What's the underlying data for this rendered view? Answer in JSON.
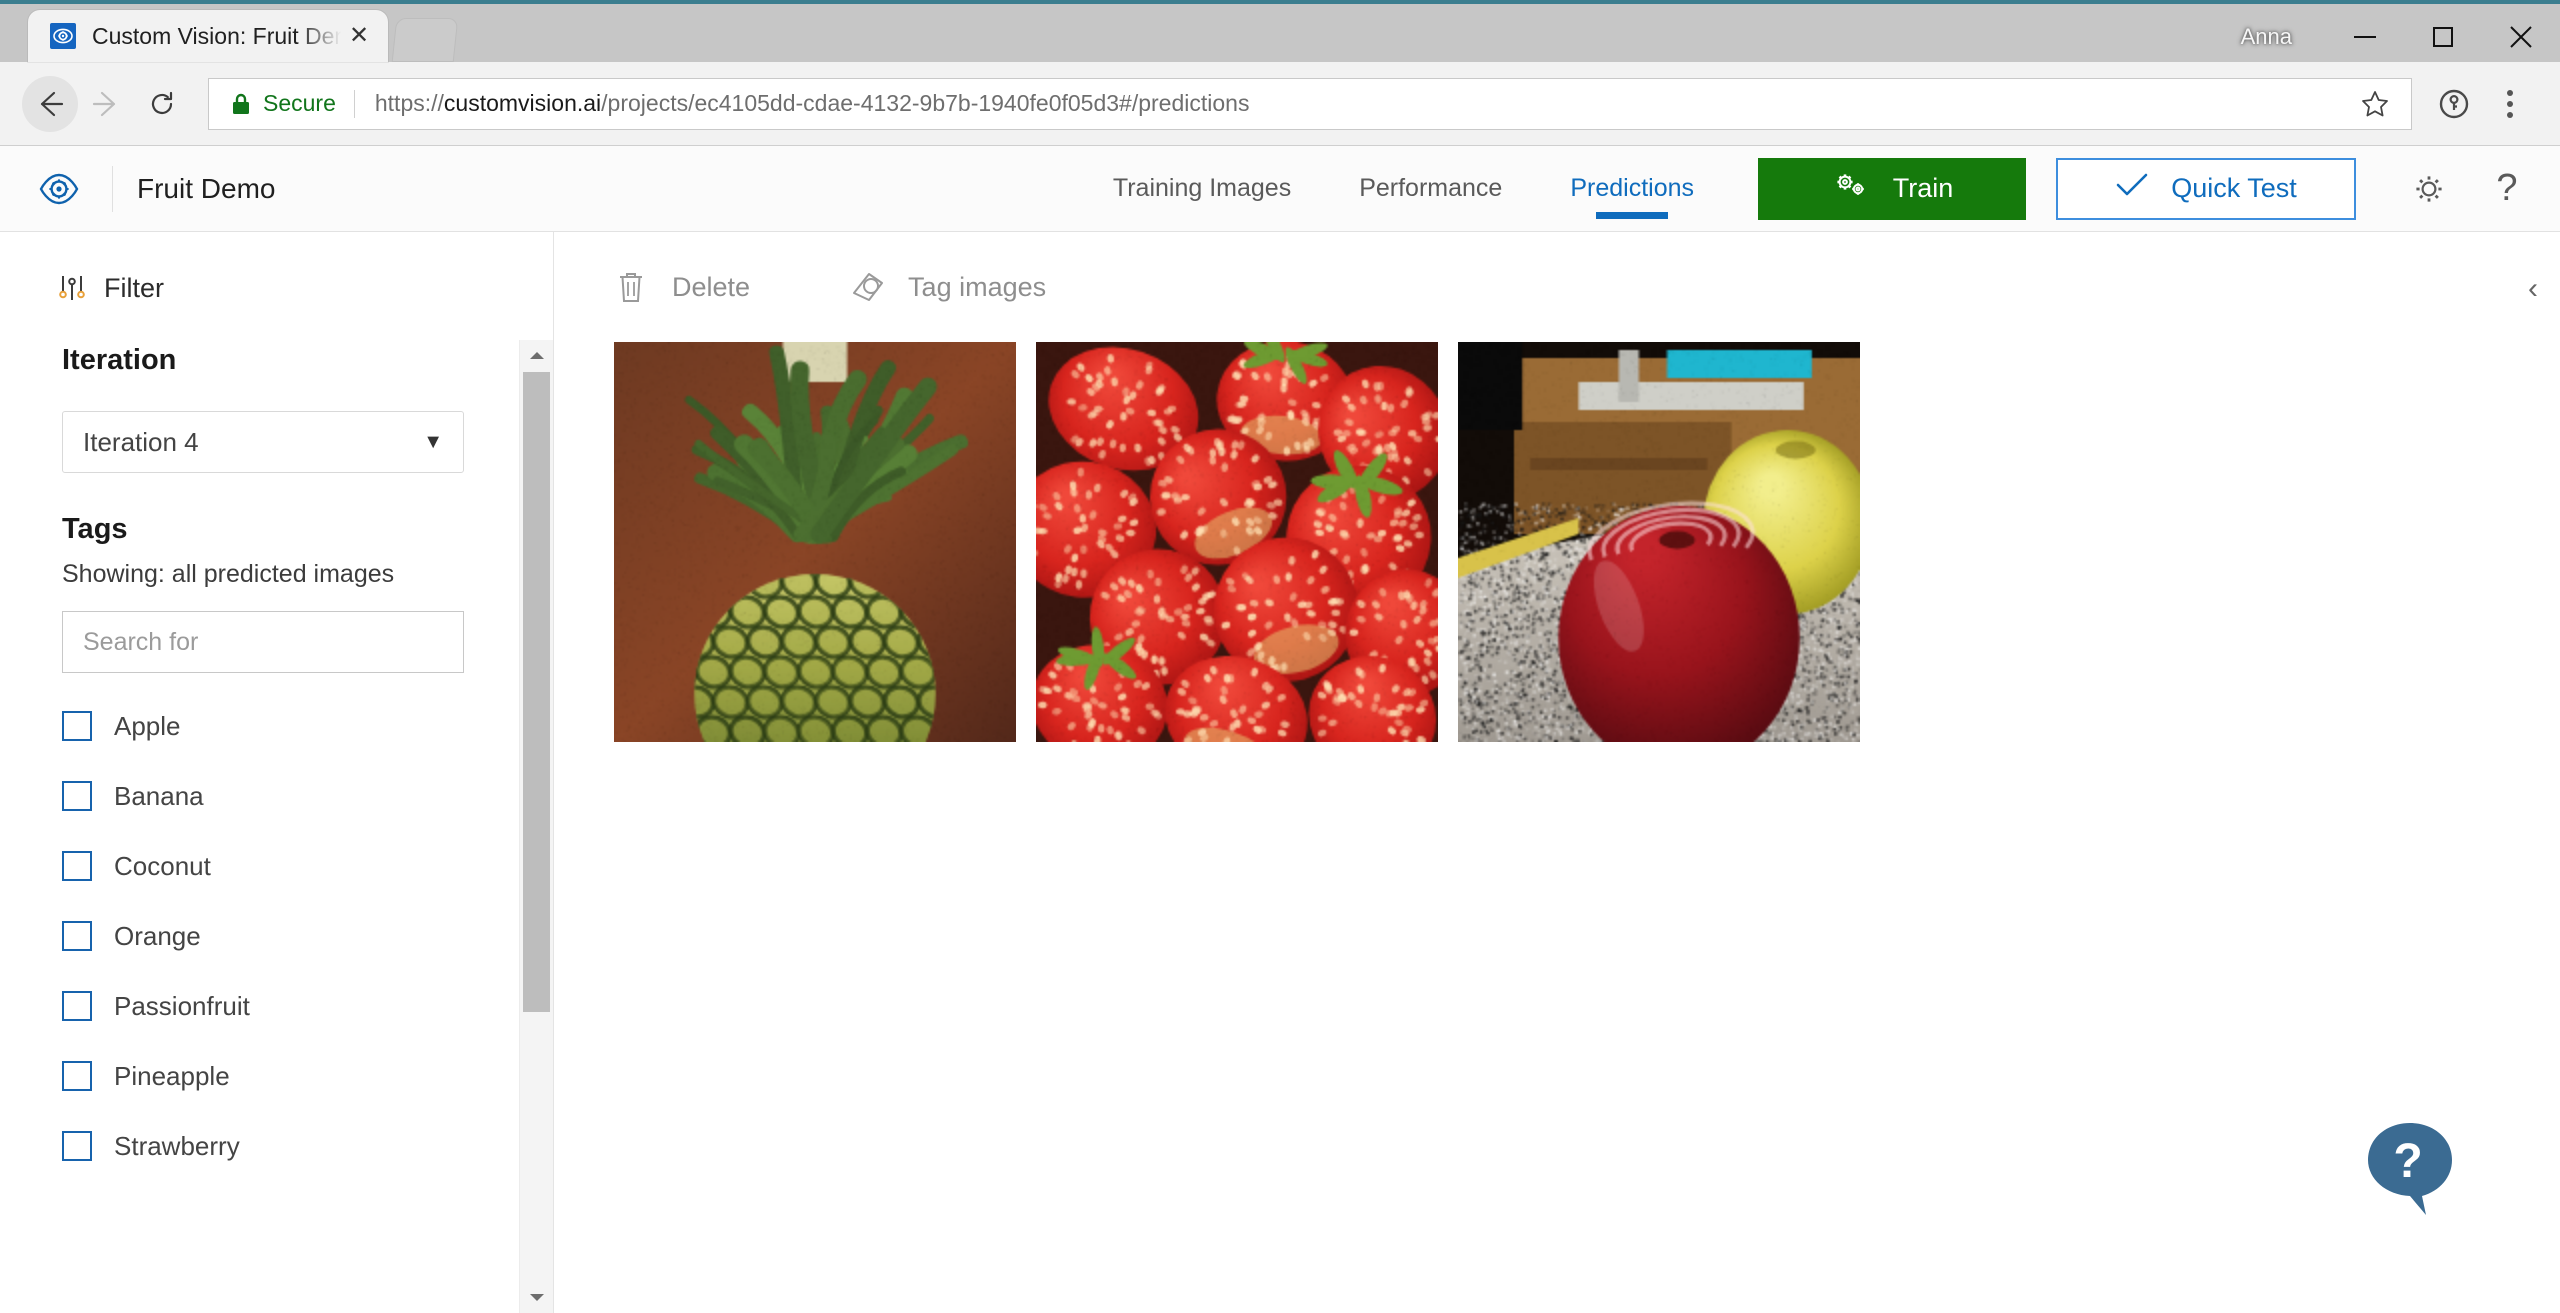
{
  "window": {
    "profile_name": "Anna",
    "minimize_label": "Minimize",
    "maximize_label": "Maximize",
    "close_label": "Close",
    "tab_title": "Custom Vision: Fruit Dem",
    "tab_close_glyph": "✕",
    "favicon_name": "custom-vision-favicon"
  },
  "browser": {
    "back_label": "Back",
    "forward_label": "Forward",
    "reload_label": "Reload",
    "secure_label": "Secure",
    "url_scheme": "https://",
    "url_host": "customvision.ai",
    "url_path": "/projects/ec4105dd-cdae-4132-9b7b-1940fe0f05d3#/predictions",
    "url_full": "https://customvision.ai/projects/ec4105dd-cdae-4132-9b7b-1940fe0f05d3#/predictions",
    "bookmark_label": "Bookmark this page",
    "menu_label": "Customize and control"
  },
  "app_header": {
    "project_title": "Fruit Demo",
    "tabs": [
      {
        "label": "Training Images",
        "active": false
      },
      {
        "label": "Performance",
        "active": false
      },
      {
        "label": "Predictions",
        "active": true
      }
    ],
    "train_label": "Train",
    "quick_test_label": "Quick Test",
    "settings_label": "Settings",
    "help_label": "?",
    "accent_blue": "#0f6cbd",
    "train_green": "#157a0c",
    "annotation_red": "#f41c1c"
  },
  "sidebar": {
    "filter_label": "Filter",
    "iteration_title": "Iteration",
    "iteration_value": "Iteration 4",
    "iteration_caret": "▼",
    "tags_title": "Tags",
    "showing_text": "Showing: all predicted images",
    "search_placeholder": "Search for",
    "search_value": "",
    "tags": [
      {
        "label": "Apple",
        "checked": false
      },
      {
        "label": "Banana",
        "checked": false
      },
      {
        "label": "Coconut",
        "checked": false
      },
      {
        "label": "Orange",
        "checked": false
      },
      {
        "label": "Passionfruit",
        "checked": false
      },
      {
        "label": "Pineapple",
        "checked": false
      },
      {
        "label": "Strawberry",
        "checked": false
      }
    ]
  },
  "content": {
    "delete_label": "Delete",
    "tag_images_label": "Tag images",
    "collapse_glyph": "‹",
    "images": [
      {
        "alt": "pineapple-thumbnail"
      },
      {
        "alt": "strawberries-thumbnail"
      },
      {
        "alt": "red-apple-thumbnail"
      }
    ]
  },
  "help_widget": {
    "glyph": "?",
    "color": "#3b6b92"
  }
}
